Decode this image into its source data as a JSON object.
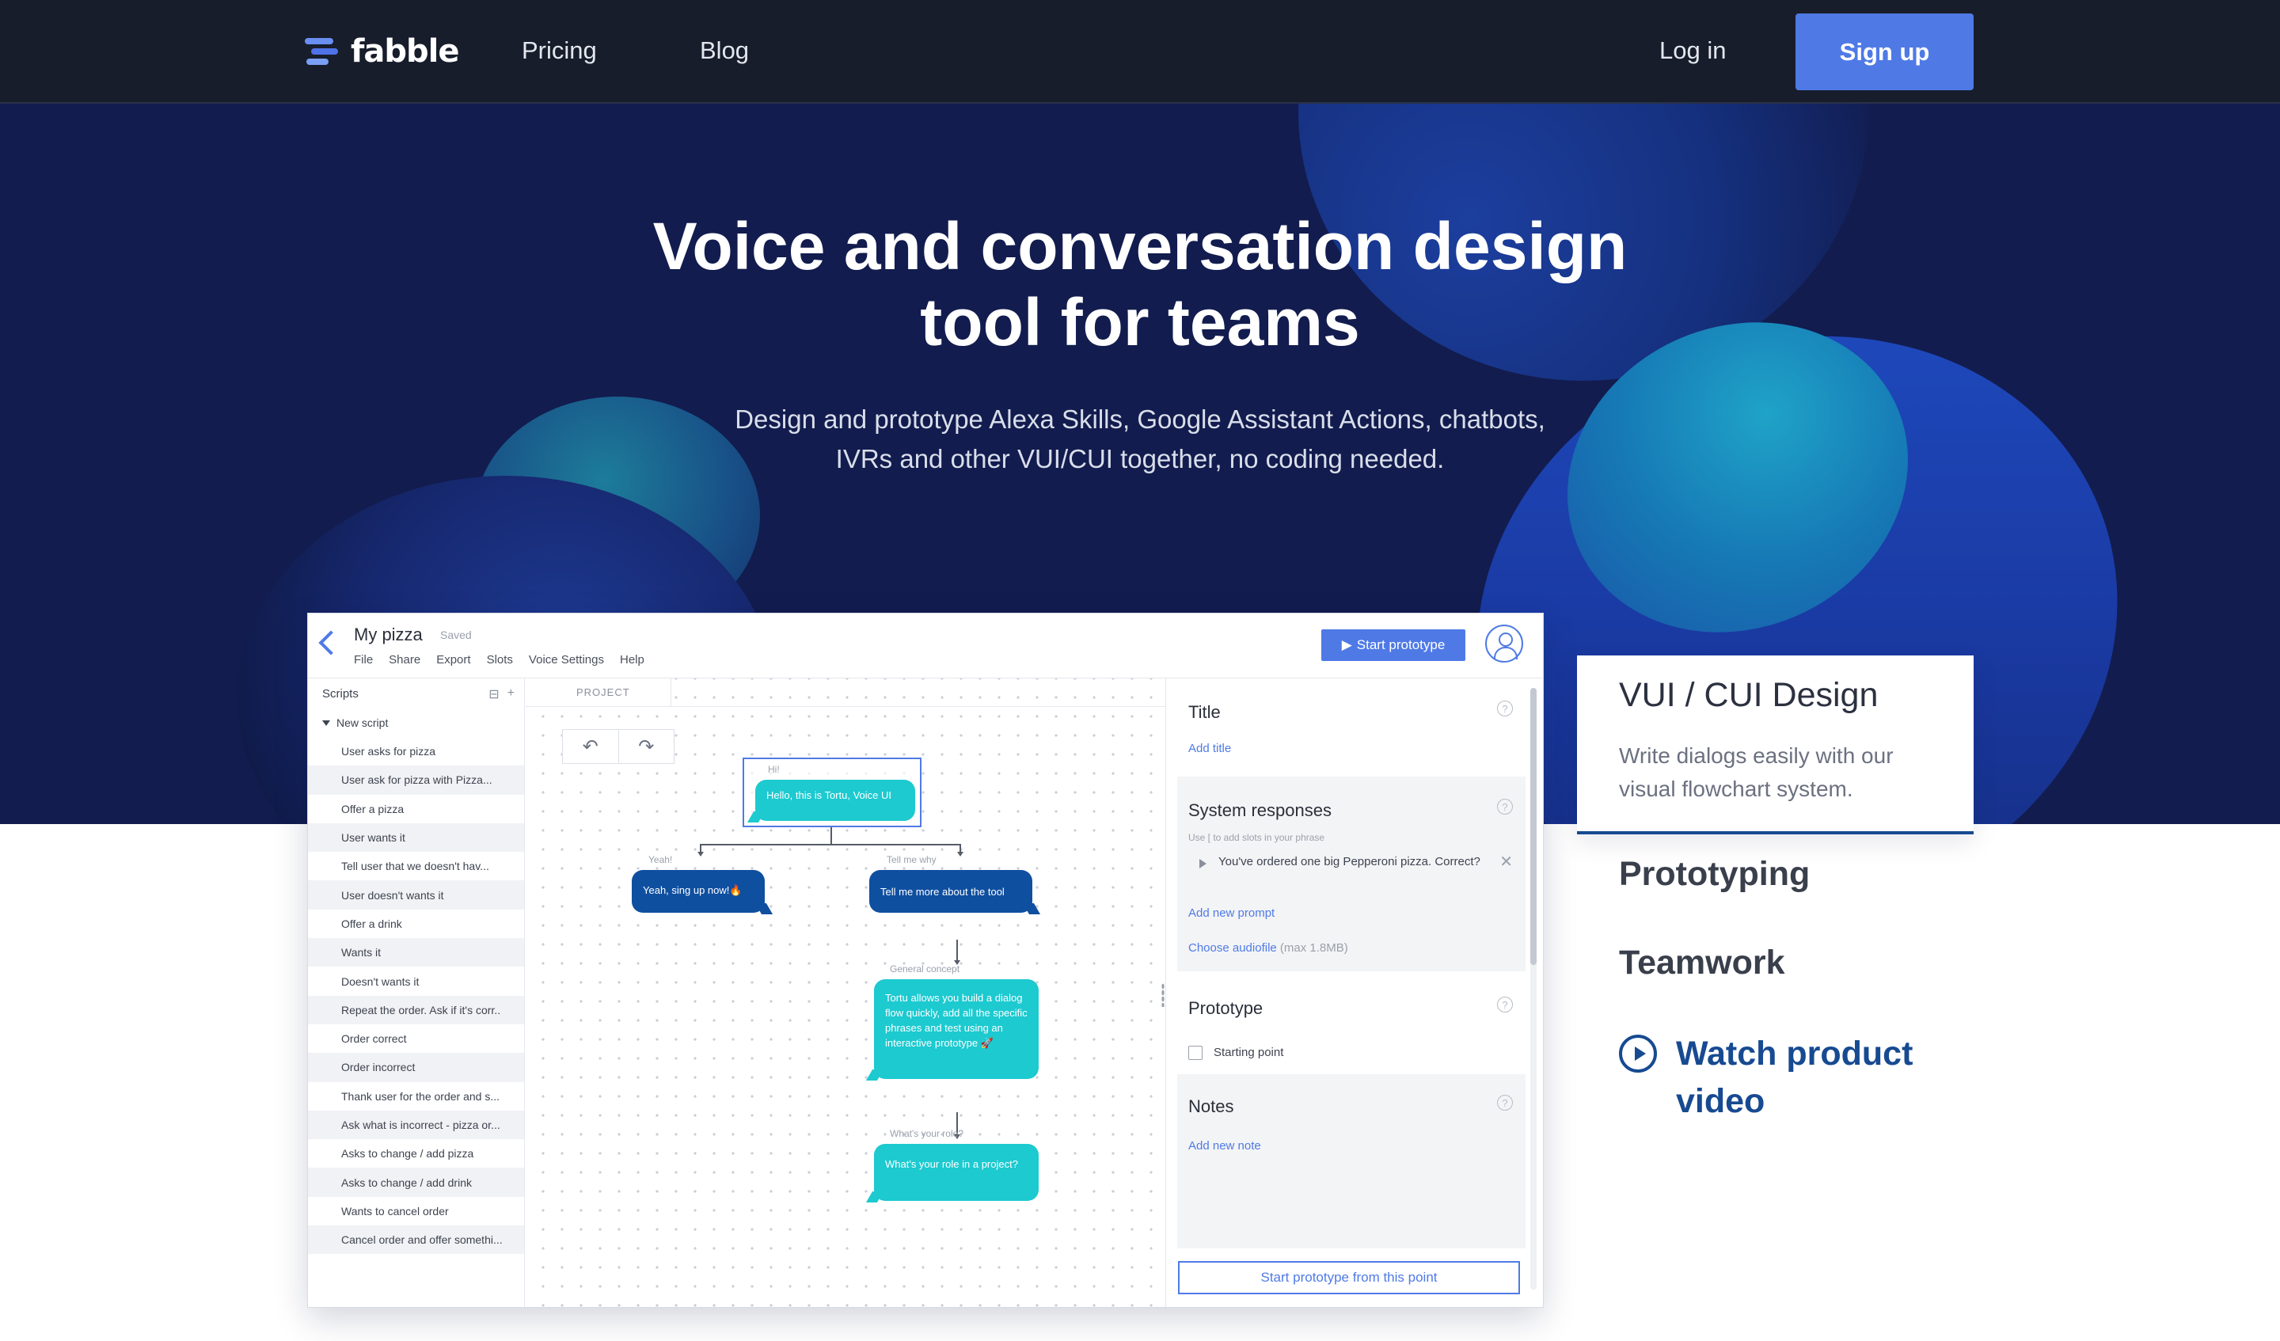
{
  "nav": {
    "logo_text": "fabble",
    "links": [
      "Pricing",
      "Blog"
    ],
    "login": "Log in",
    "signup": "Sign up"
  },
  "hero": {
    "title_line1": "Voice and conversation design",
    "title_line2": "tool for teams",
    "subtitle_line1": "Design and prototype Alexa Skills, Google Assistant Actions, chatbots,",
    "subtitle_line2": "IVRs and other VUI/CUI together, no coding needed."
  },
  "app": {
    "project_name": "My pizza",
    "saved": "Saved",
    "menu": [
      "File",
      "Share",
      "Export",
      "Slots",
      "Voice Settings",
      "Help"
    ],
    "start_prototype": "Start prototype",
    "scripts_header": "Scripts",
    "new_script": "New script",
    "scripts": [
      "User asks for pizza",
      "User ask for pizza with Pizza...",
      "Offer a pizza",
      "User wants it",
      "Tell user that we doesn't hav...",
      "User doesn't wants it",
      "Offer a drink",
      "Wants it",
      "Doesn't wants it",
      "Repeat the order. Ask if it's corr..",
      "Order correct",
      "Order incorrect",
      "Thank user for the order and s...",
      "Ask what is incorrect - pizza or...",
      "Asks to change / add pizza",
      "Asks to change / add drink",
      "Wants to cancel order",
      "Cancel order and offer somethi..."
    ],
    "canvas": {
      "tab": "PROJECT",
      "undo": "↶",
      "redo": "↷",
      "hi_label": "Hi!",
      "node_hello": "Hello, this is Tortu, Voice UI",
      "label_yeah": "Yeah!",
      "node_yeah": "Yeah, sing up now!🔥",
      "label_tell": "Tell me why",
      "node_tell": "Tell me more about the tool",
      "label_general": "General concept",
      "node_general": "Tortu allows you build a dialog flow quickly, add all the specific phrases and test using an interactive prototype 🚀",
      "label_role": "What's your role?",
      "node_role": "What's your role in a project?"
    },
    "props": {
      "title_heading": "Title",
      "add_title": "Add title",
      "system_heading": "System responses",
      "system_hint": "Use [ to add slots in your phrase",
      "prompt_text": "You've ordered one big Pepperoni pizza. Correct?",
      "add_prompt": "Add new prompt",
      "choose_audio": "Choose audiofile",
      "audio_max": "(max 1.8MB)",
      "prototype_heading": "Prototype",
      "starting_point": "Starting point",
      "notes_heading": "Notes",
      "add_note": "Add new note",
      "start_from_point": "Start prototype from this point",
      "help_glyph": "?",
      "close_glyph": "✕"
    }
  },
  "features": {
    "active_title": "VUI / CUI Design",
    "active_desc": "Write dialogs easily with our visual flowchart system.",
    "tabs": [
      "Prototyping",
      "Teamwork"
    ],
    "watch_video": "Watch product video"
  },
  "colors": {
    "nav_bg": "#181d2c",
    "hero_bg": "#121c4e",
    "accent": "#4f7ae6",
    "teal": "#1ccad0",
    "navy_bubble": "#0f4fa0",
    "link_dark": "#174a91"
  }
}
